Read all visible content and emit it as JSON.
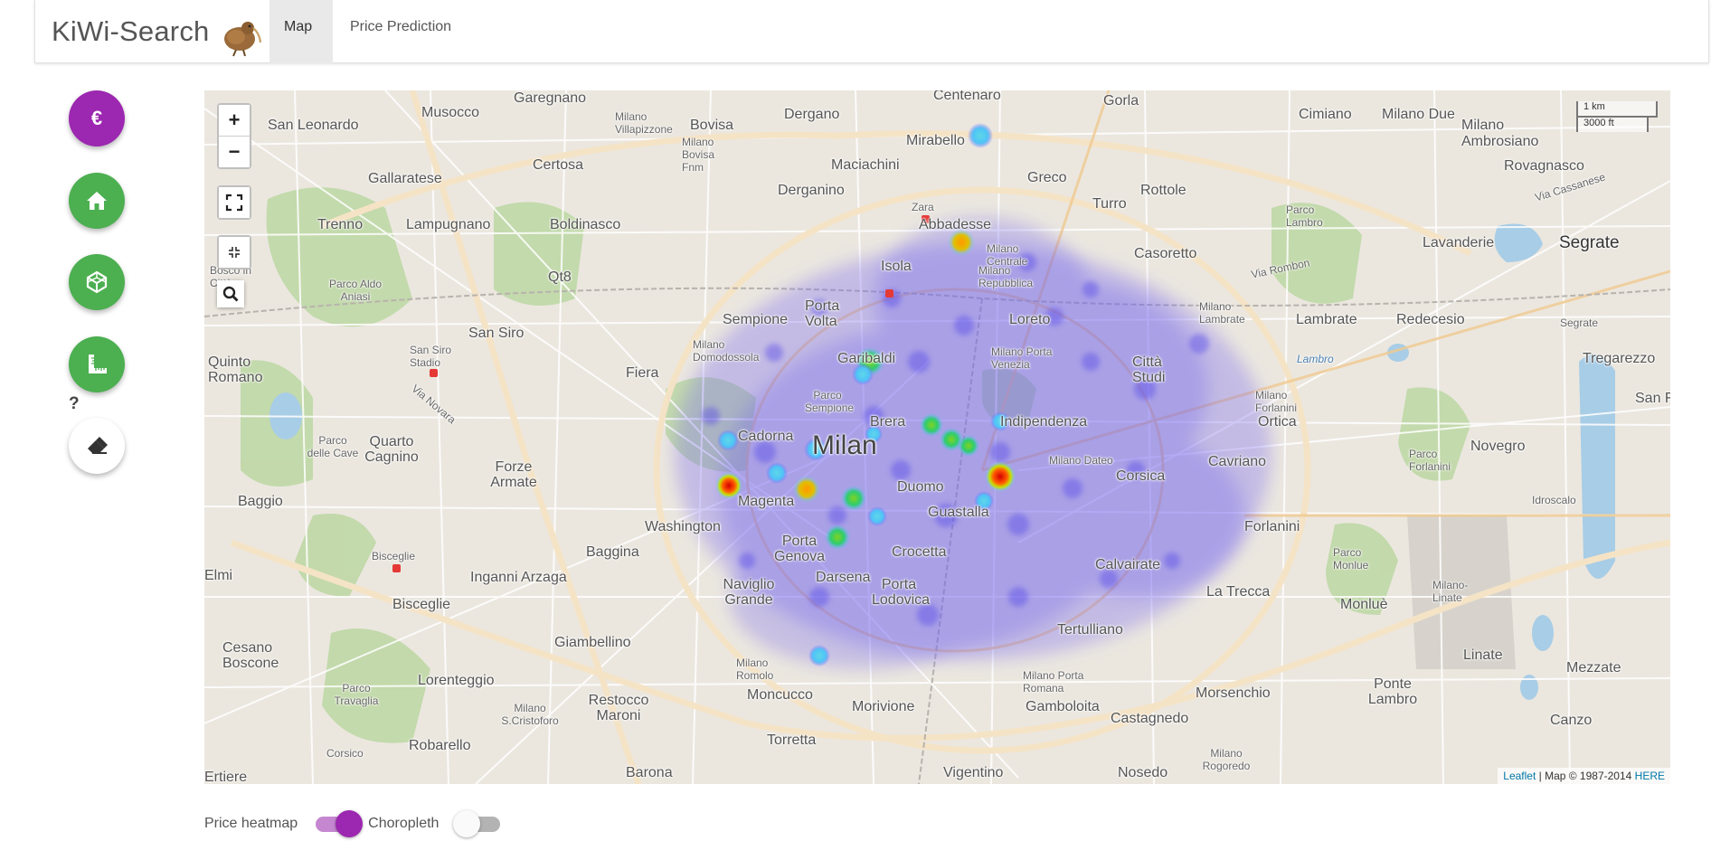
{
  "navbar": {
    "brand": "KiWi-Search",
    "tabs": [
      {
        "label": "Map",
        "active": true
      },
      {
        "label": "Price Prediction",
        "active": false
      }
    ]
  },
  "sidebar": {
    "buttons": [
      {
        "icon": "euro-icon",
        "color": "#9c27b0"
      },
      {
        "icon": "home-icon",
        "color": "#4caf50"
      },
      {
        "icon": "cube-icon",
        "color": "#4caf50"
      },
      {
        "icon": "ruler-icon",
        "color": "#4caf50"
      },
      {
        "icon": "eraser-icon",
        "color": "#ffffff"
      }
    ],
    "help": "?"
  },
  "map": {
    "controls": {
      "zoom_in": "+",
      "zoom_out": "−"
    },
    "scale": {
      "metric": "1 km",
      "imperial": "3000 ft"
    },
    "attribution": {
      "leaflet": "Leaflet",
      "separator": " | Map © 1987-2014 ",
      "here": "HERE"
    },
    "labels": [
      "Musocco",
      "Garegnano",
      "Bovisa",
      "Dergano",
      "Centenaro",
      "Gorla",
      "Cimiano",
      "Milano Due",
      "San Leonardo",
      "Milano Villapizzone",
      "Milano Bovisa Fnm",
      "Maciachini",
      "Mirabello",
      "Greco",
      "Milano Ambrosiano",
      "Rovagnasco",
      "Gallaratese",
      "Certosa",
      "Derganino",
      "Zara",
      "Rottole",
      "Turro",
      "Parco Lambro",
      "Via Cassanese",
      "Segrate",
      "Trenno",
      "Lampugnano",
      "Boldinasco",
      "Abbadesse",
      "Milano Centrale",
      "Casoretto",
      "Lavanderie",
      "Via Rombon",
      "Parco Aldo Aniasi",
      "Qt8",
      "Isola",
      "Milano Lambrate",
      "Porta Volta",
      "Sempione",
      "Milano Repubblica",
      "Loreto",
      "Lambrate",
      "Redecesio",
      "Segrate",
      "San Siro",
      "Milano Domodossola",
      "Milano Porta Venezia",
      "San Siro Stadio",
      "Garibaldi",
      "Tregarezzo",
      "Quinto Romano",
      "Fiera",
      "Città Studi",
      "Lambro",
      "Parco Sempione",
      "Milano Forlanini",
      "Via Novara",
      "Indipendenza",
      "Ortica",
      "San Felice",
      "Brera",
      "Novegro",
      "Parco delle Cave",
      "Quarto Cagnino",
      "Cadorna",
      "Milan",
      "Milano Dateo",
      "Cavriano",
      "Forze Armate",
      "Parco Forlanini",
      "Idroscalo",
      "Duomo",
      "Corsica",
      "Baggio",
      "Magenta",
      "Guastalla",
      "Washington",
      "Forlanini",
      "Porta Genova",
      "Crocetta",
      "Baggina",
      "Bisceglie",
      "Calvairate",
      "Parco Monlue",
      "Inganni Arzaga",
      "Darsena",
      "Naviglio Grande",
      "Porta Lodovica",
      "La Trecca",
      "Monluè",
      "Milano-Linate",
      "Bisceglie",
      "Giambellino",
      "Tertulliano",
      "Cesano Boscone",
      "Linate",
      "Mezzate",
      "Milano Romolo",
      "Milano Porta Romana",
      "Parco Travaglia",
      "Lorenteggio",
      "Restocco Maroni",
      "Morsenchio",
      "Ponte Lambro",
      "Moncucco",
      "Morivione",
      "Gamboloita",
      "Milano S.Cristoforo",
      "Castagnedo",
      "Canzo",
      "Robarello",
      "Torretta",
      "Corsico",
      "Milano Rogoredo",
      "Barona",
      "Vigentino",
      "Nosedo",
      "Ertiere",
      "Elmi",
      "Bosco in Città"
    ]
  },
  "toggles": {
    "price_heatmap": {
      "label": "Price heatmap",
      "on": true,
      "color": "#9c27b0"
    },
    "choropleth": {
      "label": "Choropleth",
      "on": false
    }
  }
}
